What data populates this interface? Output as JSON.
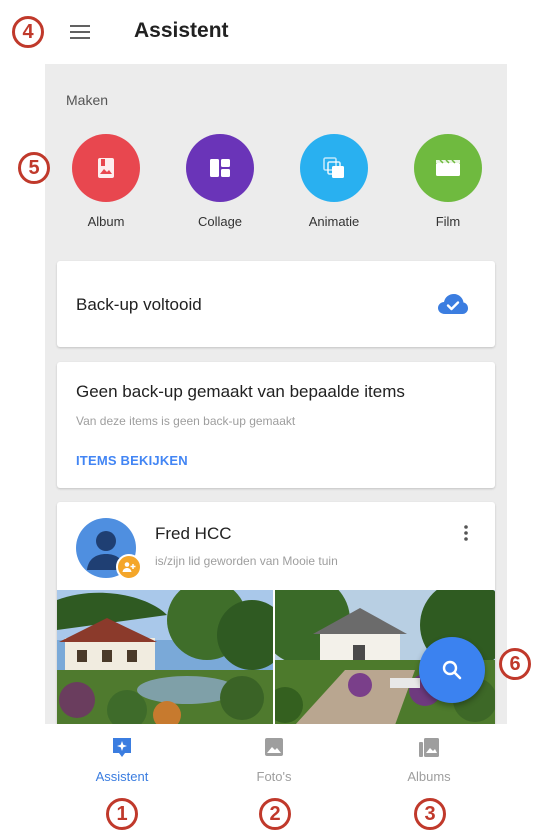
{
  "header": {
    "title": "Assistent"
  },
  "create": {
    "heading": "Maken",
    "items": [
      {
        "label": "Album",
        "color": "#e8474f",
        "icon": "album-icon"
      },
      {
        "label": "Collage",
        "color": "#6a34b8",
        "icon": "collage-icon"
      },
      {
        "label": "Animatie",
        "color": "#29b0f0",
        "icon": "animation-icon"
      },
      {
        "label": "Film",
        "color": "#6fba3f",
        "icon": "movie-icon"
      }
    ]
  },
  "backup_card": {
    "text": "Back-up voltooid",
    "icon": "cloud-done-icon",
    "icon_color": "#3b7de0"
  },
  "items_card": {
    "title": "Geen back-up gemaakt van bepaalde items",
    "subtitle": "Van deze items is geen back-up gemaakt",
    "action": "ITEMS BEKIJKEN"
  },
  "person_card": {
    "name": "Fred HCC",
    "subtitle": "is/zijn lid geworden van Mooie tuin",
    "more_icon": "more-vert-icon"
  },
  "fab": {
    "icon": "search-icon",
    "color": "#3b82f0"
  },
  "bottom_nav": {
    "items": [
      {
        "label": "Assistent",
        "active": true,
        "icon": "assistant-icon"
      },
      {
        "label": "Foto's",
        "active": false,
        "icon": "photo-icon"
      },
      {
        "label": "Albums",
        "active": false,
        "icon": "albums-icon"
      }
    ],
    "active_color": "#3b7de0",
    "inactive_color": "#9e9e9e"
  },
  "callouts": [
    "1",
    "2",
    "3",
    "4",
    "5",
    "6"
  ],
  "accent_color": "#c0392b"
}
